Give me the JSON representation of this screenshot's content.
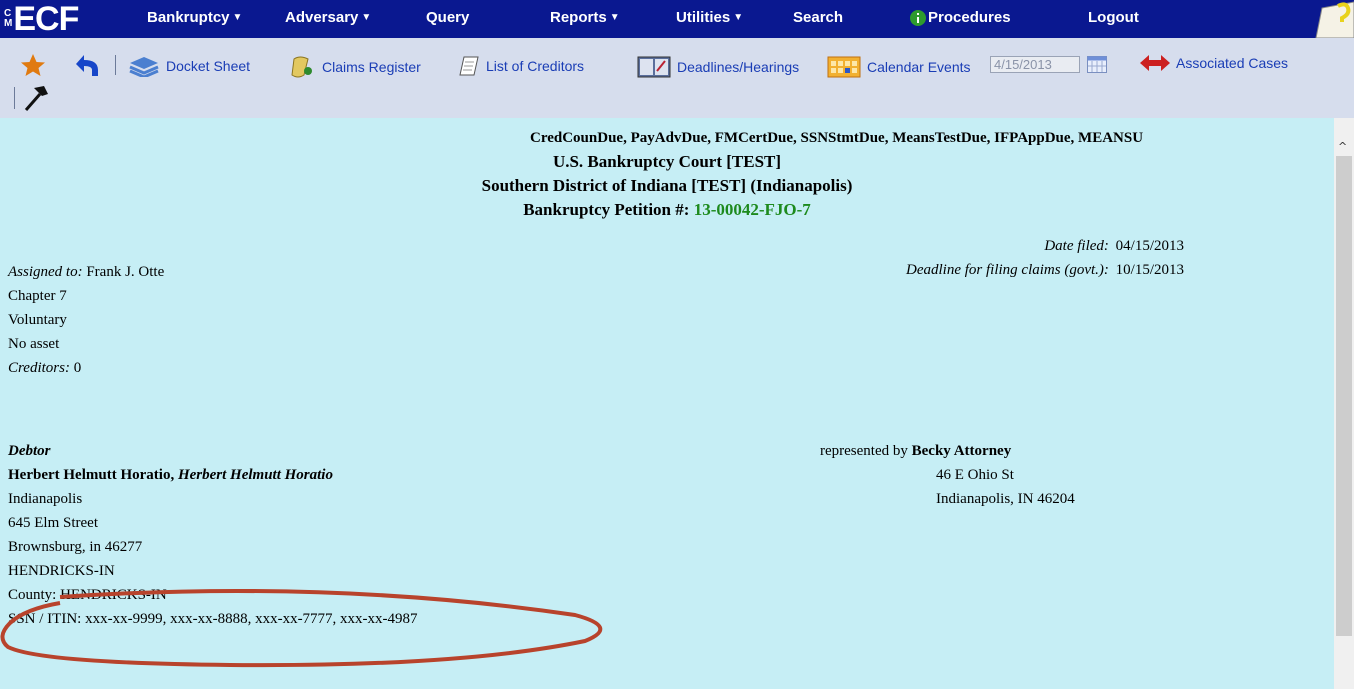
{
  "app": {
    "logo_cm_top": "C",
    "logo_cm_bottom": "M",
    "logo_text": "ECF"
  },
  "menu": [
    {
      "label": "Bankruptcy",
      "dropdown": true
    },
    {
      "label": "Adversary",
      "dropdown": true
    },
    {
      "label": "Query",
      "dropdown": false
    },
    {
      "label": "Reports",
      "dropdown": true
    },
    {
      "label": "Utilities",
      "dropdown": true
    },
    {
      "label": "Search",
      "dropdown": false
    },
    {
      "label": "Procedures",
      "dropdown": false
    },
    {
      "label": "Logout",
      "dropdown": false
    }
  ],
  "toolbar": {
    "docket_sheet": "Docket Sheet",
    "claims_register": "Claims Register",
    "list_of_creditors": "List of Creditors",
    "deadlines_hearings": "Deadlines/Hearings",
    "calendar_events": "Calendar Events",
    "calendar_date": "4/15/2013",
    "associated_cases": "Associated Cases"
  },
  "case": {
    "flags": "CredCounDue, PayAdvDue, FMCertDue, SSNStmtDue, MeansTestDue, IFPAppDue, MEANSU",
    "court": "U.S. Bankruptcy Court [TEST]",
    "district": "Southern District of Indiana [TEST] (Indianapolis)",
    "petition_label": "Bankruptcy Petition #:",
    "petition_number": "13-00042-FJO-7",
    "date_filed_label": "Date filed:",
    "date_filed": "04/15/2013",
    "deadline_label": "Deadline for filing claims (govt.):",
    "deadline": "10/15/2013",
    "assigned_label": "Assigned to:",
    "assigned_to": "Frank J. Otte",
    "chapter": "Chapter 7",
    "voluntary": "Voluntary",
    "asset": "No asset",
    "creditors_label": "Creditors:",
    "creditors": "0"
  },
  "debtor": {
    "heading": "Debtor",
    "name": "Herbert Helmutt Horatio,",
    "alias": "Herbert Helmutt Horatio",
    "city": "Indianapolis",
    "street": "645 Elm Street",
    "city_state_zip": "Brownsburg, in 46277",
    "county": "HENDRICKS-IN",
    "county_line": "County: HENDRICKS-IN",
    "ssn": "SSN / ITIN: xxx-xx-9999, xxx-xx-8888, xxx-xx-7777, xxx-xx-4987"
  },
  "attorney": {
    "represented_by": "represented by",
    "name": "Becky Attorney",
    "street": "46 E Ohio St",
    "city_state_zip": "Indianapolis, IN 46204"
  },
  "colors": {
    "menubar": "#0a1890",
    "toolbar": "#d6dded",
    "content_bg": "#c6eef5",
    "link": "#1a3db5",
    "petition_number": "#1d8a1d",
    "annotation": "#b8432c"
  },
  "icons": [
    "star-icon",
    "back-arrow-icon",
    "docket-stack-icon",
    "claims-scroll-icon",
    "notepad-icon",
    "deadlines-book-icon",
    "calendar-icon",
    "calendar-picker-icon",
    "double-arrow-icon",
    "hammer-icon",
    "info-icon",
    "help-icon"
  ]
}
